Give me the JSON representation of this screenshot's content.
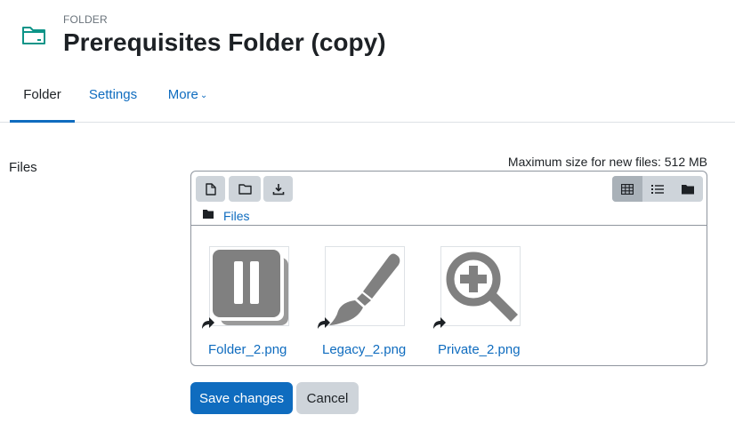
{
  "header": {
    "kicker": "FOLDER",
    "title": "Prerequisites Folder (copy)",
    "icon": "folder-outline-icon",
    "icon_color": "#0d9488"
  },
  "tabs": [
    {
      "label": "Folder",
      "active": true
    },
    {
      "label": "Settings",
      "active": false
    },
    {
      "label": "More",
      "active": false,
      "icon": "chevron-down-icon"
    }
  ],
  "form": {
    "files_label": "Files",
    "max_size": "Maximum size for new files: 512 MB"
  },
  "filemanager": {
    "toolbar": [
      "add-file-icon",
      "create-folder-icon",
      "download-icon"
    ],
    "views": [
      "grid-view-icon",
      "list-view-icon",
      "tree-view-icon"
    ],
    "active_view": "grid",
    "breadcrumb": "Files",
    "files": [
      {
        "name": "Folder_2.png",
        "thumb": "pause-stack-icon"
      },
      {
        "name": "Legacy_2.png",
        "thumb": "paintbrush-icon"
      },
      {
        "name": "Private_2.png",
        "thumb": "zoom-in-icon"
      }
    ]
  },
  "actions": {
    "save_label": "Save changes",
    "cancel_label": "Cancel"
  },
  "colors": {
    "link": "#0f6cbf",
    "primary": "#0f6cbf",
    "secondary": "#ced4da",
    "thumb_gray": "#808080"
  }
}
